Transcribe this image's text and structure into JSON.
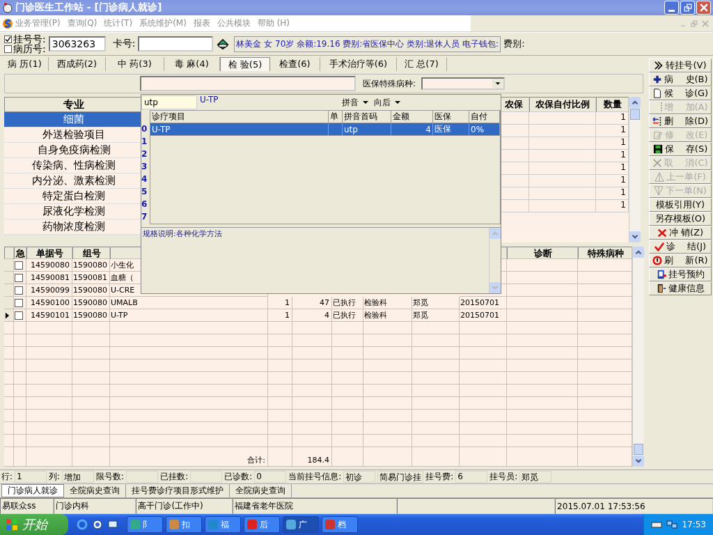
{
  "window": {
    "title": "门诊医生工作站 - [门诊病人就诊]"
  },
  "menu": [
    "业务管理(P)",
    "查询(Q)",
    "统计(T)",
    "系统维护(M)",
    "报表",
    "公共模块",
    "帮助 (H)"
  ],
  "patient": {
    "checks": [
      {
        "label": "挂号号:",
        "checked": true
      },
      {
        "label": "病历号:",
        "checked": false
      }
    ],
    "number": "3063263",
    "card_label": "卡号:",
    "info": "林美金 女 70岁 余额:19.16 费别:省医保中心 类别:退休人员 电子钱包:",
    "fee_label": "费别:"
  },
  "tabs": [
    {
      "label": "病 历(1)",
      "selected": false
    },
    {
      "label": "西成药(2)",
      "selected": false
    },
    {
      "label": "中 药(3)",
      "selected": false
    },
    {
      "label": "毒 麻(4)",
      "selected": false
    },
    {
      "label": "检 验(5)",
      "selected": true
    },
    {
      "label": "检查(6)",
      "selected": false
    },
    {
      "label": "手术治疗等(6)",
      "selected": false
    },
    {
      "label": "汇 总(7)",
      "selected": false
    }
  ],
  "filter": {
    "label": "医保特殊病种:"
  },
  "specialties": {
    "heading": "专业",
    "items": [
      {
        "label": "细菌",
        "selected": true
      },
      {
        "label": "外送检验项目",
        "selected": false
      },
      {
        "label": "自身免疫病检测",
        "selected": false
      },
      {
        "label": "传染病、性病检测",
        "selected": false
      },
      {
        "label": "内分泌、激素检测",
        "selected": false
      },
      {
        "label": "特定蛋白检测",
        "selected": false
      },
      {
        "label": "尿液化学检测",
        "selected": false
      },
      {
        "label": "药物浓度检测",
        "selected": false
      }
    ]
  },
  "upper_table": {
    "columns": [
      "农保",
      "农保自付比例",
      "数量"
    ],
    "rows": [
      {
        "quantity": "1"
      },
      {
        "quantity": "1"
      },
      {
        "quantity": "1"
      },
      {
        "quantity": "1"
      },
      {
        "quantity": "1"
      },
      {
        "quantity": "1"
      },
      {
        "quantity": "1"
      },
      {
        "quantity": "1"
      }
    ]
  },
  "popup": {
    "query": "utp",
    "match": "U-TP",
    "options": [
      "拼音",
      "向后"
    ],
    "columns": [
      "诊疗项目",
      "单",
      "拼音首码",
      "金额",
      "医保",
      "自付"
    ],
    "row_numbers": [
      "0",
      "1",
      "2",
      "3",
      "4",
      "5",
      "6",
      "7"
    ],
    "rows": [
      {
        "item": "U-TP",
        "pinyin": "utp",
        "amount": "4",
        "insurance": "医保",
        "self_pay": "0%",
        "selected": true
      }
    ],
    "spec": "规格说明:各种化学方法"
  },
  "orders": {
    "columns": [
      "急",
      "单据号",
      "组号",
      "诊断",
      "特殊病种"
    ],
    "rows": [
      {
        "current": false,
        "urgent": false,
        "doc": "14590080",
        "group": "1590080",
        "name": "小生化"
      },
      {
        "current": false,
        "urgent": false,
        "doc": "14590081",
        "group": "1590081",
        "name": "血糖（"
      },
      {
        "current": false,
        "urgent": false,
        "doc": "14590099",
        "group": "1590080",
        "name": "U-CRE"
      },
      {
        "current": false,
        "urgent": false,
        "doc": "14590100",
        "group": "1590080",
        "name": "UMALB",
        "qty": "1",
        "amount": "47",
        "status": "已执行",
        "dept": "检验科",
        "doctor": "郑觅",
        "date": "20150701"
      },
      {
        "current": true,
        "urgent": false,
        "doc": "14590101",
        "group": "1590080",
        "name": "U-TP",
        "qty": "1",
        "amount": "4",
        "status": "已执行",
        "dept": "检验科",
        "doctor": "郑觅",
        "date": "20150701"
      }
    ],
    "total_label": "合计:",
    "total": "184.4"
  },
  "actions": [
    {
      "label": "转挂号(V)",
      "kind": "chevrons",
      "disabled": false
    },
    {
      "label": "病　 史(B)",
      "kind": "plus",
      "disabled": false
    },
    {
      "label": "候　 诊(G)",
      "kind": "page",
      "disabled": false
    },
    {
      "label": "增　 加(A)",
      "kind": "dots",
      "disabled": true
    },
    {
      "label": "删　 除(D)",
      "kind": "delete",
      "disabled": false
    },
    {
      "label": "修　 改(E)",
      "kind": "edit",
      "disabled": true
    },
    {
      "label": "保　 存(S)",
      "kind": "save",
      "disabled": false
    },
    {
      "label": "取　 消(C)",
      "kind": "cross",
      "disabled": true
    },
    {
      "label": "上一单(F)",
      "kind": "up",
      "disabled": true
    },
    {
      "label": "下一单(N)",
      "kind": "down",
      "disabled": true
    },
    {
      "label": "模板引用(Y)",
      "kind": "text",
      "disabled": false
    },
    {
      "label": "另存模板(O)",
      "kind": "text",
      "disabled": false
    },
    {
      "label": "冲 销(Z)",
      "kind": "x",
      "disabled": false
    },
    {
      "label": "诊　 结(J)",
      "kind": "check",
      "disabled": false
    },
    {
      "label": "刷　 新(R)",
      "kind": "refresh",
      "disabled": false
    },
    {
      "label": "挂号预约",
      "kind": "book",
      "disabled": false
    },
    {
      "label": "健康信息",
      "kind": "door",
      "disabled": false
    }
  ],
  "info_row": [
    {
      "label": "行:",
      "value": "1"
    },
    {
      "label": "列:",
      "value": "增加"
    },
    {
      "label": "限号数:"
    },
    {
      "label": "已挂数:"
    },
    {
      "label": "已诊数:",
      "value": "0"
    },
    {
      "label": "当前挂号信息:",
      "value": "初诊"
    },
    {
      "value": "简易门诊挂"
    },
    {
      "label": "挂号费:",
      "value": "6"
    },
    {
      "label": "挂号员:",
      "value": "郑觅"
    }
  ],
  "bottom_tabs": [
    {
      "label": "门诊病人就诊",
      "selected": true
    },
    {
      "label": "全院病史查询",
      "selected": false
    },
    {
      "label": "挂号费诊疗项目形式维护",
      "selected": false
    },
    {
      "label": "全院病史查询",
      "selected": false
    }
  ],
  "status_bar": [
    "易联众ss",
    "门诊内科",
    "高干门诊(工作中)",
    "福建省老年医院",
    "2015.07.01 17:53:56"
  ],
  "taskbar": {
    "start": "开始",
    "tasks": [
      {
        "label": "阝",
        "selected": false
      },
      {
        "label": "扣",
        "selected": false
      },
      {
        "label": "福",
        "selected": false
      },
      {
        "label": "后",
        "selected": false
      },
      {
        "label": "广",
        "selected": true
      },
      {
        "label": "档",
        "selected": false
      }
    ],
    "clock": "17:53"
  }
}
